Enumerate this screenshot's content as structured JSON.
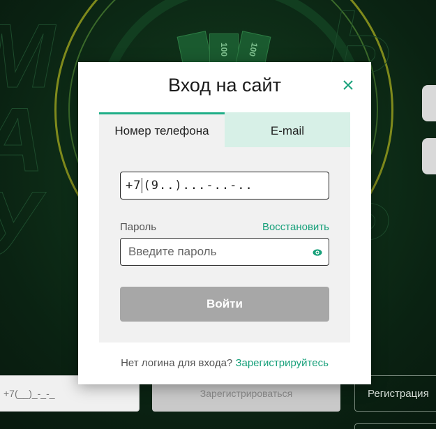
{
  "background": {
    "wheel_values": [
      "100",
      "100"
    ],
    "bottom_phone_text": "+7(__)_-_-_",
    "bottom_submit_label": "Зарегистрироваться",
    "bottom_register_label": "Регистрация"
  },
  "modal": {
    "title": "Вход на сайт",
    "close_icon": "close-icon",
    "tabs": [
      {
        "label": "Номер телефона",
        "active": true
      },
      {
        "label": "E-mail",
        "active": false
      }
    ],
    "phone": {
      "prefix": "+7",
      "mask": "(9..)...-..-.."
    },
    "password": {
      "label": "Пароль",
      "restore_link": "Восстановить",
      "placeholder": "Введите пароль",
      "toggle_icon": "eye-icon"
    },
    "login_button": "Войти",
    "footer": {
      "text": "Нет логина для входа?",
      "register_link": "Зарегистрируйтесь"
    }
  },
  "colors": {
    "accent": "#17a07a",
    "tab_inactive_bg": "#d7f0e7",
    "button_disabled": "#a7a7a7",
    "background": "#0b2113"
  }
}
